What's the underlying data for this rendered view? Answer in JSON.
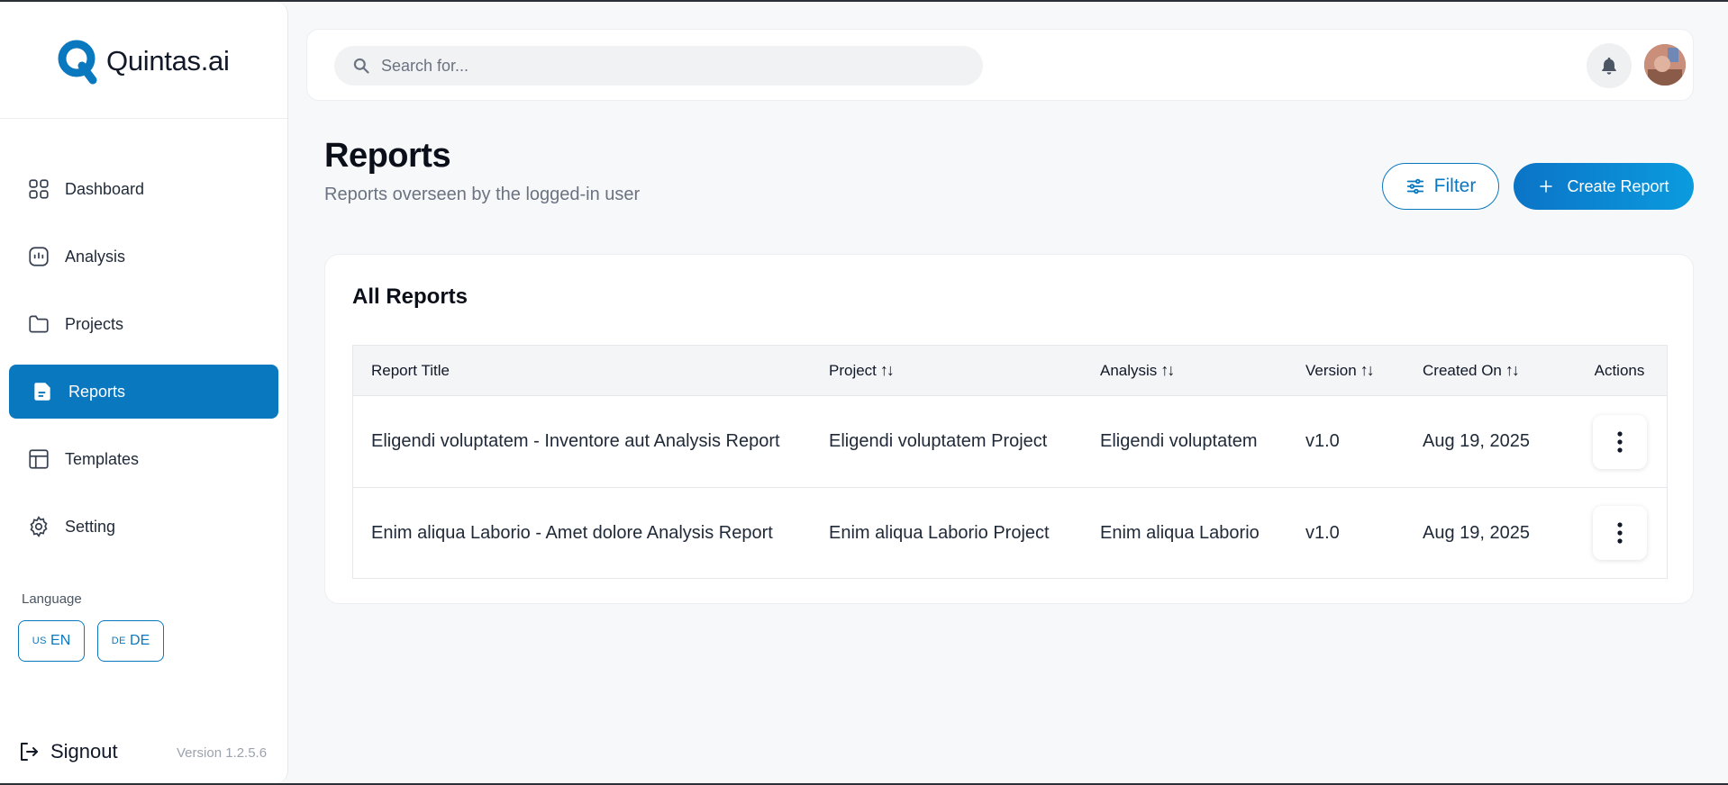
{
  "app": {
    "brand": "Quintas.ai",
    "brand_color": "#0a78bf"
  },
  "sidebar": {
    "items": [
      {
        "label": "Dashboard",
        "icon": "grid-icon",
        "active": false
      },
      {
        "label": "Analysis",
        "icon": "analysis-icon",
        "active": false
      },
      {
        "label": "Projects",
        "icon": "folder-icon",
        "active": false
      },
      {
        "label": "Reports",
        "icon": "report-document-icon",
        "active": true
      },
      {
        "label": "Templates",
        "icon": "template-icon",
        "active": false
      },
      {
        "label": "Setting",
        "icon": "gear-icon",
        "active": false
      }
    ],
    "language_label": "Language",
    "languages": [
      {
        "flag": "US",
        "code": "EN"
      },
      {
        "flag": "DE",
        "code": "DE"
      }
    ],
    "signout_label": "Signout",
    "version": "Version 1.2.5.6"
  },
  "header": {
    "search_placeholder": "Search for...",
    "notification_icon": "bell-icon",
    "avatar_icon": "user-avatar"
  },
  "page": {
    "title": "Reports",
    "subtitle": "Reports overseen by the logged-in user",
    "filter_label": "Filter",
    "create_label": "Create Report"
  },
  "table": {
    "title": "All Reports",
    "columns": [
      "Report Title",
      "Project",
      "Analysis",
      "Version",
      "Created On",
      "Actions"
    ],
    "sort_glyph": "↑↓",
    "rows": [
      {
        "report_title": "Eligendi voluptatem - Inventore aut Analysis Report",
        "project": "Eligendi voluptatem Project",
        "analysis": "Eligendi voluptatem",
        "version": "v1.0",
        "created_on": "Aug 19, 2025"
      },
      {
        "report_title": "Enim aliqua Laborio - Amet dolore Analysis Report",
        "project": "Enim aliqua Laborio Project",
        "analysis": "Enim aliqua Laborio",
        "version": "v1.0",
        "created_on": "Aug 19, 2025"
      }
    ]
  }
}
